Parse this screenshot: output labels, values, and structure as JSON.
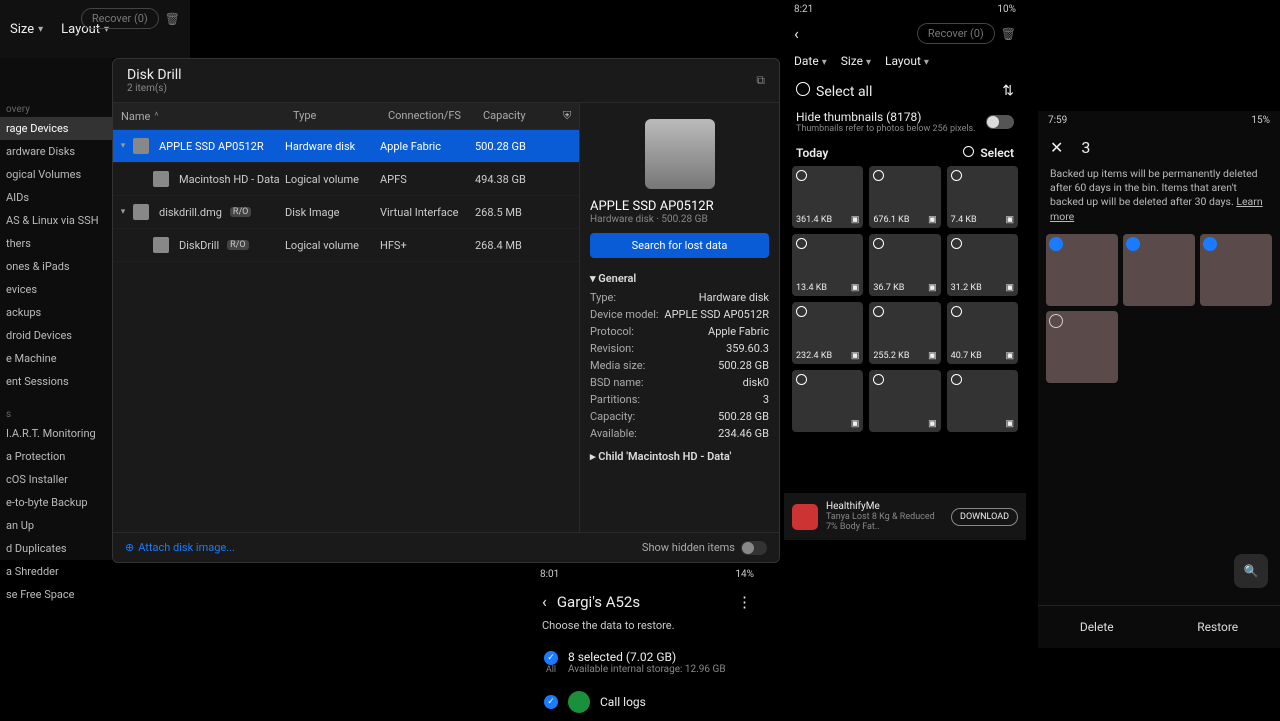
{
  "dd": {
    "chips": {
      "size": "Size",
      "layout": "Layout"
    },
    "recover": "Recover (0)",
    "sidebar": {
      "hdr1": "overy",
      "items": [
        "rage Devices",
        "ardware Disks",
        "ogical Volumes",
        "AIDs",
        "AS & Linux via SSH",
        "thers",
        "ones & iPads",
        "evices",
        "ackups",
        "droid Devices",
        "e Machine",
        "ent Sessions"
      ],
      "hdr2": "s",
      "tools": [
        "I.A.R.T. Monitoring",
        "a Protection",
        "cOS Installer",
        "e-to-byte Backup",
        "an Up",
        "d Duplicates",
        "a Shredder",
        "se Free Space"
      ]
    },
    "title": "Disk Drill",
    "sub": "2 item(s)",
    "cols": {
      "name": "Name",
      "type": "Type",
      "conn": "Connection/FS",
      "cap": "Capacity"
    },
    "rows": [
      {
        "tri": "▾",
        "name": "APPLE SSD AP0512R",
        "type": "Hardware disk",
        "conn": "Apple Fabric",
        "cap": "500.28 GB",
        "sel": true,
        "indent": 0
      },
      {
        "tri": "",
        "name": "Macintosh HD - Data",
        "type": "Logical volume",
        "conn": "APFS",
        "cap": "494.38 GB",
        "indent": 1
      },
      {
        "tri": "▾",
        "name": "diskdrill.dmg",
        "type": "Disk Image",
        "conn": "Virtual Interface",
        "cap": "268.5 MB",
        "badge": "R/O",
        "indent": 0
      },
      {
        "tri": "",
        "name": "DiskDrill",
        "type": "Logical volume",
        "conn": "HFS+",
        "cap": "268.4 MB",
        "badge": "R/O",
        "indent": 1
      }
    ],
    "detail": {
      "name": "APPLE SSD AP0512R",
      "sub": "Hardware disk · 500.28 GB",
      "scan": "Search for lost data",
      "general": "General",
      "kv": [
        [
          "Type:",
          "Hardware disk"
        ],
        [
          "Device model:",
          "APPLE SSD AP0512R"
        ],
        [
          "Protocol:",
          "Apple Fabric"
        ],
        [
          "Revision:",
          "359.60.3"
        ],
        [
          "Media size:",
          "500.28 GB"
        ],
        [
          "BSD name:",
          "disk0"
        ],
        [
          "Partitions:",
          "3"
        ],
        [
          "Capacity:",
          "500.28 GB"
        ],
        [
          "Available:",
          "234.46 GB"
        ]
      ],
      "child": "Child 'Macintosh HD - Data'"
    },
    "attach": "Attach disk image...",
    "hidden": "Show hidden items"
  },
  "phoneA": {
    "time": "8:21",
    "batt": "10%",
    "recover": "Recover (0)",
    "chips": {
      "date": "Date",
      "size": "Size",
      "layout": "Layout"
    },
    "select_all": "Select all",
    "hide": "Hide thumbnails (8178)",
    "hide_sub": "Thumbnails refer to photos below 256 pixels.",
    "today": "Today",
    "select": "Select",
    "thumbs": [
      "361.4 KB",
      "676.1 KB",
      "7.4 KB",
      "13.4 KB",
      "36.7 KB",
      "31.2 KB",
      "232.4 KB",
      "255.2 KB",
      "40.7 KB",
      "",
      "",
      ""
    ],
    "ad": {
      "title": "HealthifyMe",
      "sub": "Tanya Lost 8 Kg & Reduced 7% Body Fat..",
      "btn": "DOWNLOAD"
    }
  },
  "phoneB": {
    "time": "8:01",
    "batt": "14%",
    "title": "Gargi's A52s",
    "sub": "Choose the data to restore.",
    "sel": "8 selected (7.02 GB)",
    "sel_sub": "Available internal storage: 12.96 GB",
    "all": "All",
    "row1": "Call logs"
  },
  "phoneC": {
    "time": "7:59",
    "batt": "15%",
    "count": "3",
    "msg": "Backed up items will be permanently deleted after 60 days in the bin. Items that aren't backed up will be deleted after 30 days. ",
    "learn": "Learn more",
    "delete": "Delete",
    "restore": "Restore"
  }
}
